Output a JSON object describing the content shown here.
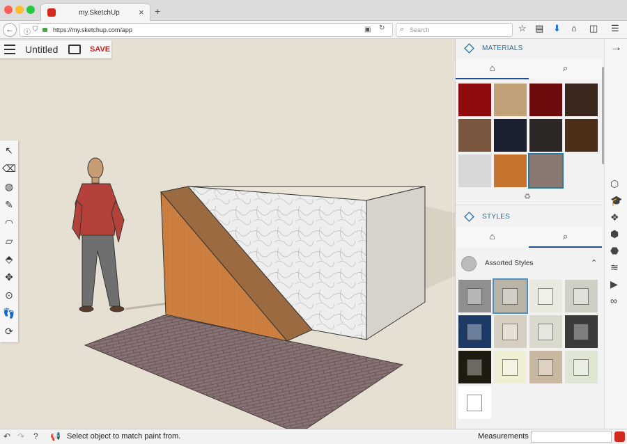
{
  "browser": {
    "tab_title": "my.SketchUp",
    "tab_close": "×",
    "new_tab": "+",
    "url": "https://my.sketchup.com/app",
    "search_placeholder": "Search",
    "back": "←"
  },
  "app": {
    "model_title": "Untitled",
    "save_label": "SAVE"
  },
  "materials_panel": {
    "header": "MATERIALS",
    "swatches": [
      {
        "name": "red",
        "color": "#8e0c0e"
      },
      {
        "name": "tan",
        "color": "#c1a177"
      },
      {
        "name": "dark-red",
        "color": "#6d0b0c"
      },
      {
        "name": "dark-brown",
        "color": "#3a271d"
      },
      {
        "name": "brown",
        "color": "#7b563f"
      },
      {
        "name": "navy",
        "color": "#1b2030"
      },
      {
        "name": "charcoal",
        "color": "#2c2725"
      },
      {
        "name": "walnut",
        "color": "#4d2e19"
      },
      {
        "name": "marble",
        "color": "#d8d8d8"
      },
      {
        "name": "wood",
        "color": "#c4742e"
      },
      {
        "name": "stone-tile",
        "color": "#8a7873"
      }
    ]
  },
  "styles_panel": {
    "header": "STYLES",
    "group_label": "Assorted Styles",
    "thumbs": [
      {
        "bg": "#8f8f8f"
      },
      {
        "bg": "#b9b4a6"
      },
      {
        "bg": "#e9e9e0"
      },
      {
        "bg": "#cfcfc6"
      },
      {
        "bg": "#1d3a66"
      },
      {
        "bg": "#d7cfc1"
      },
      {
        "bg": "#d9d9cc"
      },
      {
        "bg": "#3a3a3a"
      },
      {
        "bg": "#1e1c10"
      },
      {
        "bg": "#efefd4"
      },
      {
        "bg": "#c9b8a1"
      },
      {
        "bg": "#dfe7d4"
      },
      {
        "bg": "#ffffff"
      }
    ]
  },
  "statusbar": {
    "message": "Select object to match paint from.",
    "measurements_label": "Measurements",
    "measurements_value": ""
  }
}
